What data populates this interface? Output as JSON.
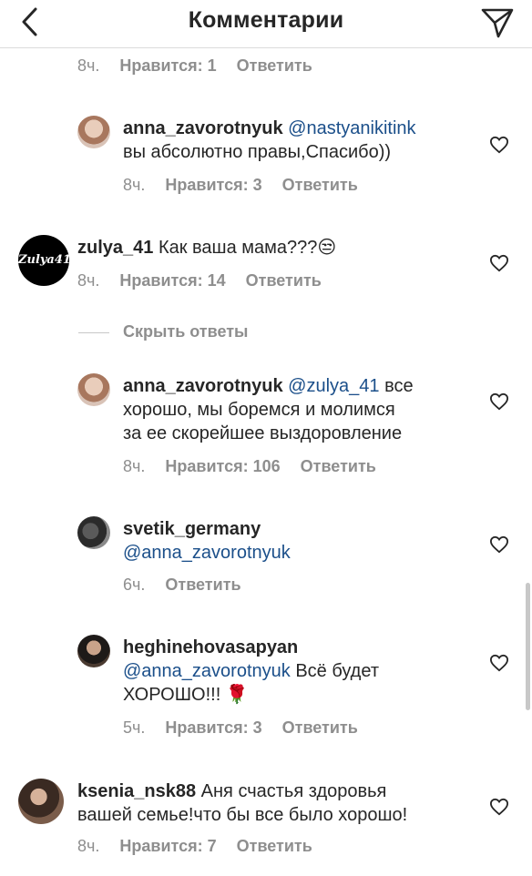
{
  "header": {
    "title": "Комментарии",
    "back_icon": "chevron-left-icon",
    "send_icon": "paper-plane-icon"
  },
  "top_meta": {
    "time": "8ч.",
    "likes": "Нравится: 1",
    "reply": "Ответить"
  },
  "comments": [
    {
      "username": "anna_zavorotnyuk",
      "mention": "@nastyanikitink",
      "text": "вы абсолютно правы,Спасибо))",
      "time": "8ч.",
      "likes": "Нравится: 3",
      "reply": "Ответить"
    },
    {
      "username": "zulya_41",
      "avatar_text": "Zulya41",
      "text": "Как ваша мама???",
      "emoji": "😒",
      "time": "8ч.",
      "likes": "Нравится: 14",
      "reply": "Ответить"
    },
    {
      "username": "anna_zavorotnyuk",
      "mention": "@zulya_41",
      "text_line1": "все",
      "text_line2": "хорошо, мы боремся и молимся",
      "text_line3": "за ее скорейшее выздоровление",
      "time": "8ч.",
      "likes": "Нравится: 106",
      "reply": "Ответить"
    },
    {
      "username": "svetik_germany",
      "mention": "@anna_zavorotnyuk",
      "time": "6ч.",
      "reply": "Ответить"
    },
    {
      "username": "heghinehovasapyan",
      "mention": "@anna_zavorotnyuk",
      "text_line1": "Всё будет",
      "text_line2": "ХОРОШО!!!",
      "emoji": "🌹",
      "time": "5ч.",
      "likes": "Нравится: 3",
      "reply": "Ответить"
    },
    {
      "username": "ksenia_nsk88",
      "text_line1": "Аня счастья здоровья",
      "text_line2": "вашей семье!что бы все было хорошо!",
      "time": "8ч.",
      "likes": "Нравится: 7",
      "reply": "Ответить"
    }
  ],
  "hide_replies": "Скрыть ответы",
  "colors": {
    "mention": "#1b4f8a",
    "meta": "#8e8e8e",
    "text": "#262626"
  }
}
